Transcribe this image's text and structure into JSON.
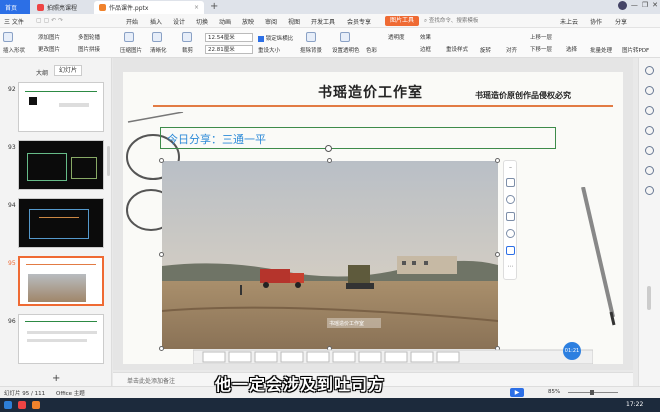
{
  "tabs": {
    "home": "首页",
    "pdf": "拍照亮课程",
    "ppt": "作品课件.pptx",
    "add": "+"
  },
  "window": {
    "cloud": "未上云",
    "collab": "协作",
    "share": "分享"
  },
  "menu": {
    "file": "三 文件",
    "items": [
      "开始",
      "插入",
      "设计",
      "切换",
      "动画",
      "放映",
      "审阅",
      "视图",
      "开发工具",
      "会员专享"
    ],
    "pic_tool": "图片工具",
    "search": "查找命令、搜索模板"
  },
  "ribbon": {
    "insert_shape": "插入形状",
    "add_pic": "添加图片",
    "replace_pic": "更改图片",
    "multi_layout": "多图轮播",
    "pic_split": "图片拼接",
    "compress": "压缩图片",
    "clarity": "清晰化",
    "crop": "裁剪",
    "height": "12.54厘米",
    "width": "22.81厘米",
    "lock_ratio": "锁定纵横比",
    "reset_size": "重设大小",
    "remove_bg": "抠除背景",
    "set_transparent": "设置透明色",
    "color": "色彩",
    "effect": "效果",
    "border": "边框",
    "reset_style": "重设样式",
    "rotate": "旋转",
    "align": "对齐",
    "up_layer": "上移一层",
    "down_layer": "下移一层",
    "select": "选择",
    "batch": "批量处理",
    "to_pdf": "图片转PDF",
    "transparency": "透明度"
  },
  "left_panel": {
    "outline_tab": "大纲",
    "slides_tab": "幻灯片",
    "slide_numbers": [
      "92",
      "93",
      "94",
      "95",
      "96"
    ],
    "add_slide": "+"
  },
  "slide": {
    "title": "书瑶造价工作室",
    "subtitle": "书瑶造价原创作品侵权必究",
    "share_title": "今日分享：三通一平",
    "watermark": "书瑶造价工作室",
    "timer": "01:21"
  },
  "notes": {
    "placeholder": "单击此处添加备注"
  },
  "status": {
    "slide_count": "幻灯片 95 / 111",
    "theme": "Office 主题",
    "zoom": "85%"
  },
  "taskbar": {
    "time": "17:22"
  },
  "caption": {
    "text": "他一定会涉及到吐司方"
  },
  "colors": {
    "accent_blue": "#2c6fe6",
    "pic_tool_orange": "#ef6a33",
    "title_line": "#e27b44",
    "share_green": "#3d8b4a",
    "share_text": "#2e8bd8"
  }
}
